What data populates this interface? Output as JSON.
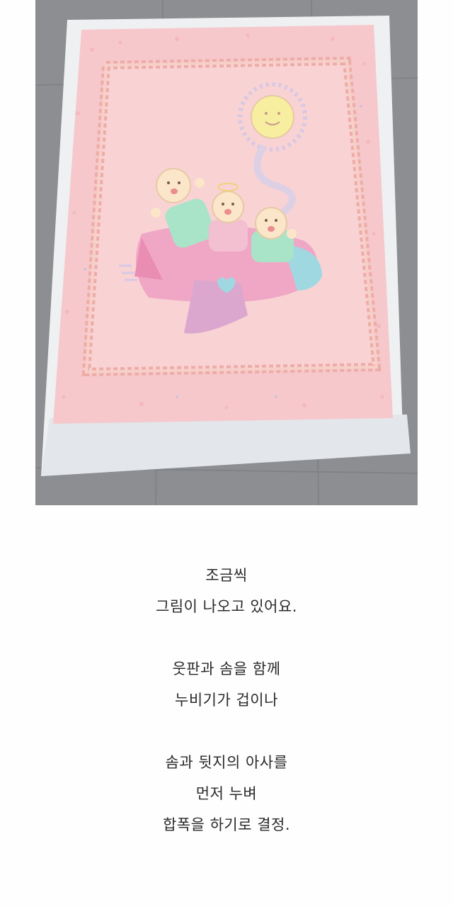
{
  "photo": {
    "subject_icon": "quilt-photo",
    "colors": {
      "floor": "#8d8e91",
      "batting": "#eef0f2",
      "quilt_pink": "#f6c8cb",
      "ruffle": "#f2b7b2",
      "sun": "#f7eea0",
      "plane": "#f0a7c5",
      "baby_green": "#a9e4c8",
      "heart_blue": "#9fd8e0"
    }
  },
  "caption": {
    "stanzas": [
      [
        "조금씩",
        "그림이 나오고 있어요."
      ],
      [
        "웃판과 솜을 함께",
        "누비기가 겁이나"
      ],
      [
        "솜과 뒷지의 아사를",
        "먼저 누벼",
        "합폭을 하기로 결정."
      ]
    ]
  }
}
